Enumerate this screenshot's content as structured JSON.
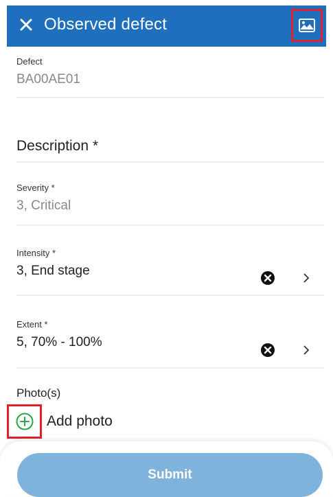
{
  "header": {
    "title": "Observed defect",
    "close_icon": "close-icon",
    "image_icon": "image-icon",
    "background": "#1f6fbf"
  },
  "fields": {
    "defect": {
      "label": "Defect",
      "value": "BA00AE01"
    },
    "description": {
      "label": "Description *"
    },
    "severity": {
      "label": "Severity *",
      "value": "3, Critical"
    },
    "intensity": {
      "label": "Intensity *",
      "value": "3, End stage"
    },
    "extent": {
      "label": "Extent *",
      "value": "5, 70% - 100%"
    }
  },
  "photos": {
    "label": "Photo(s)",
    "add_label": "Add photo",
    "add_icon": "add-circle-icon"
  },
  "submit_label": "Submit",
  "colors": {
    "accent": "#1f6fbf",
    "submit": "#7fb3dc",
    "highlight": "#e0202a",
    "add_icon": "#2aa34a"
  }
}
